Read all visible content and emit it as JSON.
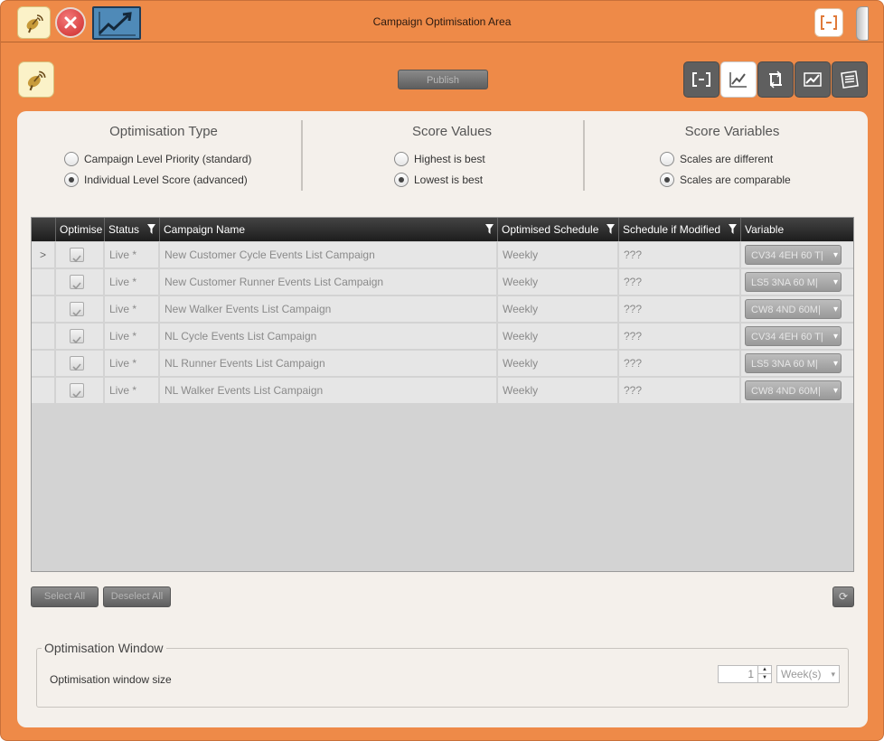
{
  "window": {
    "title": "Campaign Optimisation Area"
  },
  "toolbar": {
    "publish_label": "Publish"
  },
  "optimisation_type": {
    "title": "Optimisation Type",
    "options": [
      {
        "label": "Campaign Level Priority (standard)",
        "selected": false
      },
      {
        "label": "Individual Level Score (advanced)",
        "selected": true
      }
    ]
  },
  "score_values": {
    "title": "Score Values",
    "options": [
      {
        "label": "Highest is best",
        "selected": false
      },
      {
        "label": "Lowest is best",
        "selected": true
      }
    ]
  },
  "score_variables": {
    "title": "Score Variables",
    "options": [
      {
        "label": "Scales are different",
        "selected": false
      },
      {
        "label": "Scales are comparable",
        "selected": true
      }
    ]
  },
  "grid": {
    "columns": [
      "Optimise",
      "Status",
      "Campaign Name",
      "Optimised Schedule",
      "Schedule if Modified",
      "Variable"
    ],
    "rows": [
      {
        "indicator": ">",
        "optimise": true,
        "status": "Live *",
        "campaign": "New Customer Cycle Events List Campaign",
        "schedule": "Weekly",
        "modified": "???",
        "variable": "CV34 4EH 60 T|"
      },
      {
        "indicator": "",
        "optimise": true,
        "status": "Live *",
        "campaign": "New Customer Runner Events List Campaign",
        "schedule": "Weekly",
        "modified": "???",
        "variable": "LS5 3NA 60 M|"
      },
      {
        "indicator": "",
        "optimise": true,
        "status": "Live *",
        "campaign": "New Walker Events List Campaign",
        "schedule": "Weekly",
        "modified": "???",
        "variable": "CW8 4ND 60M|"
      },
      {
        "indicator": "",
        "optimise": true,
        "status": "Live *",
        "campaign": "NL Cycle Events List Campaign",
        "schedule": "Weekly",
        "modified": "???",
        "variable": "CV34 4EH 60 T|"
      },
      {
        "indicator": "",
        "optimise": true,
        "status": "Live *",
        "campaign": "NL Runner Events List Campaign",
        "schedule": "Weekly",
        "modified": "???",
        "variable": "LS5 3NA 60 M|"
      },
      {
        "indicator": "",
        "optimise": true,
        "status": "Live *",
        "campaign": "NL Walker Events List Campaign",
        "schedule": "Weekly",
        "modified": "???",
        "variable": "CW8 4ND 60M|"
      }
    ]
  },
  "actions": {
    "select_all": "Select All",
    "deselect_all": "Deselect All"
  },
  "optimisation_window": {
    "legend": "Optimisation Window",
    "label": "Optimisation window size",
    "size_value": "1",
    "unit": "Week(s)"
  }
}
